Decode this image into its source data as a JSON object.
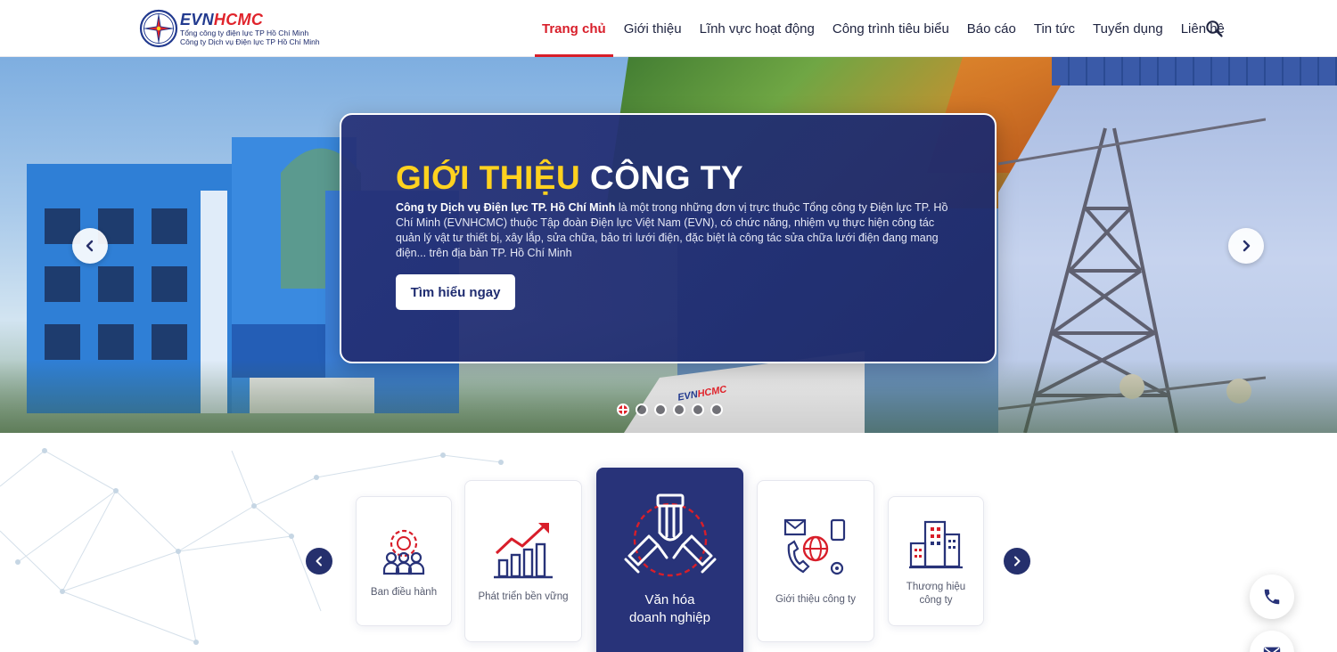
{
  "header": {
    "logo": {
      "brand_a": "EVN",
      "brand_b": "HCMC",
      "line1": "Tổng công ty điện lực TP Hồ Chí Minh",
      "line2": "Công ty Dịch vụ Điện lực TP Hồ Chí Minh"
    },
    "nav": [
      {
        "label": "Trang chủ",
        "active": true
      },
      {
        "label": "Giới thiệu",
        "active": false
      },
      {
        "label": "Lĩnh vực hoạt động",
        "active": false
      },
      {
        "label": "Công trình tiêu biểu",
        "active": false
      },
      {
        "label": "Báo cáo",
        "active": false
      },
      {
        "label": "Tin tức",
        "active": false
      },
      {
        "label": "Tuyển dụng",
        "active": false
      },
      {
        "label": "Liên hệ",
        "active": false
      }
    ],
    "search_icon": "search-icon"
  },
  "hero": {
    "title_highlight": "GIỚI THIỆU",
    "title_rest": "CÔNG TY",
    "desc_bold": "Công ty Dịch vụ Điện lực TP. Hồ Chí Minh",
    "desc_rest": " là một trong những đơn vị trực thuộc Tổng công ty Điện lực TP. Hồ Chí Minh (EVNHCMC) thuộc Tập đoàn Điện lực Việt Nam (EVN), có chức năng, nhiệm vụ thực hiện công tác quản lý vật tư thiết bị, xây lắp, sửa chữa, bảo trì lưới điện, đặc biệt là công tác sửa chữa lưới điện đang mang điện... trên địa bàn TP. Hồ Chí Minh",
    "cta_label": "Tìm hiểu ngay",
    "slides_count": 6,
    "active_slide": 1,
    "truck_brand_a": "EVN",
    "truck_brand_b": "HCMC"
  },
  "features": {
    "items": [
      {
        "label": "Ban điều hành",
        "icon": "team-gear-icon"
      },
      {
        "label": "Phát triển bền vững",
        "icon": "growth-chart-icon"
      },
      {
        "label": "Văn hóa\ndoanh nghiệp",
        "icon": "hands-together-icon",
        "active": true
      },
      {
        "label": "Giới thiệu công ty",
        "icon": "global-contact-icon"
      },
      {
        "label": "Thương hiệu\ncông ty",
        "icon": "buildings-icon"
      }
    ]
  },
  "floating": {
    "phone_icon": "phone-icon",
    "mail_icon": "mail-icon"
  },
  "colors": {
    "brand_navy": "#283379",
    "brand_red": "#d81e2a",
    "title_yellow": "#ffd21f"
  }
}
